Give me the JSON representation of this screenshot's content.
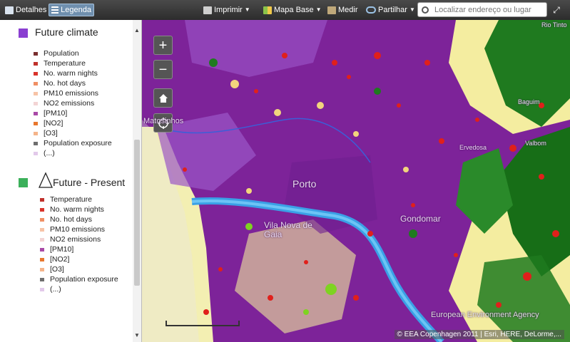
{
  "toolbar": {
    "details_label": "Detalhes",
    "legend_label": "Legenda",
    "print_label": "Imprimir",
    "basemap_label": "Mapa Base",
    "measure_label": "Medir",
    "share_label": "Partilhar",
    "search_placeholder": "Localizar endereço ou lugar"
  },
  "legend": {
    "future_climate": {
      "title": "Future climate",
      "color": "#8a3fd1",
      "items": [
        {
          "label": "Population",
          "color": "#7a2f2f"
        },
        {
          "label": "Temperature",
          "color": "#c0312b"
        },
        {
          "label": "No. warm nights",
          "color": "#d9342b"
        },
        {
          "label": "No. hot days",
          "color": "#f08f64"
        },
        {
          "label": "PM10 emissions",
          "color": "#f7c3a6"
        },
        {
          "label": "NO2 emissions",
          "color": "#f3d4d4"
        },
        {
          "label": "[PM10]",
          "color": "#a94aa7"
        },
        {
          "label": "[NO2]",
          "color": "#e8772e"
        },
        {
          "label": "[O3]",
          "color": "#f5b48a"
        },
        {
          "label": "Population exposure",
          "color": "#6e6e6e"
        },
        {
          "label": "(...)",
          "color": "#e2c9ea"
        }
      ]
    },
    "future_present": {
      "title": "Future - Present",
      "color": "#3bb05a",
      "items": [
        {
          "label": "Temperature",
          "color": "#c0312b"
        },
        {
          "label": "No. warm nights",
          "color": "#d9342b"
        },
        {
          "label": "No. hot days",
          "color": "#f08f64"
        },
        {
          "label": "PM10 emissions",
          "color": "#f7c3a6"
        },
        {
          "label": "NO2 emissions",
          "color": "#f3d4d4"
        },
        {
          "label": "[PM10]",
          "color": "#a94aa7"
        },
        {
          "label": "[NO2]",
          "color": "#e8772e"
        },
        {
          "label": "[O3]",
          "color": "#f5b48a"
        },
        {
          "label": "Population exposure",
          "color": "#6e6e6e"
        },
        {
          "label": "(...)",
          "color": "#e2c9ea"
        }
      ]
    }
  },
  "map": {
    "labels": {
      "matosinhos": "Matosinhos",
      "porto": "Porto",
      "gaia": "Vila Nova de Gaia",
      "gondomar": "Gondomar",
      "ervedosa": "Ervedosa",
      "baguim": "Baguim",
      "valbom": "Valbom",
      "rio_tinto": "Rio Tinto"
    },
    "attribution": "© EEA Copenhagen 2011 | Esri, HERE, DeLorme,...",
    "watermark": "European Environment Agency"
  }
}
